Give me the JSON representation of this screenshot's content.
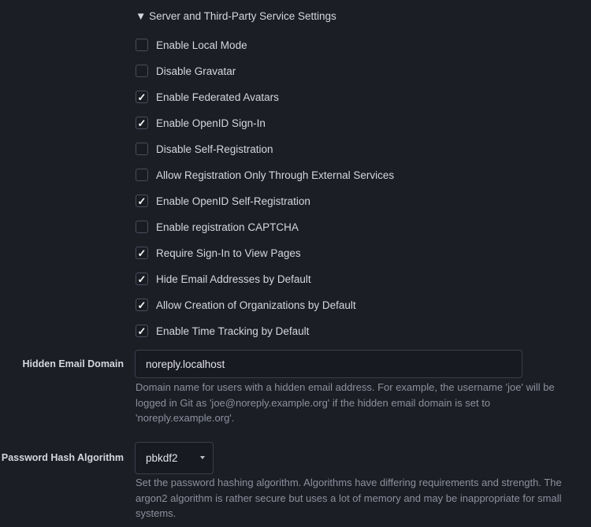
{
  "section": {
    "title": "Server and Third-Party Service Settings",
    "toggle_icon": "triangle-down"
  },
  "checkboxes": [
    {
      "label": "Enable Local Mode",
      "checked": false
    },
    {
      "label": "Disable Gravatar",
      "checked": false
    },
    {
      "label": "Enable Federated Avatars",
      "checked": true
    },
    {
      "label": "Enable OpenID Sign-In",
      "checked": true
    },
    {
      "label": "Disable Self-Registration",
      "checked": false
    },
    {
      "label": "Allow Registration Only Through External Services",
      "checked": false
    },
    {
      "label": "Enable OpenID Self-Registration",
      "checked": true
    },
    {
      "label": "Enable registration CAPTCHA",
      "checked": false
    },
    {
      "label": "Require Sign-In to View Pages",
      "checked": true
    },
    {
      "label": "Hide Email Addresses by Default",
      "checked": true
    },
    {
      "label": "Allow Creation of Organizations by Default",
      "checked": true
    },
    {
      "label": "Enable Time Tracking by Default",
      "checked": true
    }
  ],
  "hidden_email": {
    "label": "Hidden Email Domain",
    "value": "noreply.localhost",
    "help": "Domain name for users with a hidden email address. For example, the username 'joe' will be logged in Git as 'joe@noreply.example.org' if the hidden email domain is set to 'noreply.example.org'."
  },
  "hash_algo": {
    "label": "Password Hash Algorithm",
    "value": "pbkdf2",
    "help": "Set the password hashing algorithm. Algorithms have differing requirements and strength. The argon2 algorithm is rather secure but uses a lot of memory and may be inappropriate for small systems."
  }
}
